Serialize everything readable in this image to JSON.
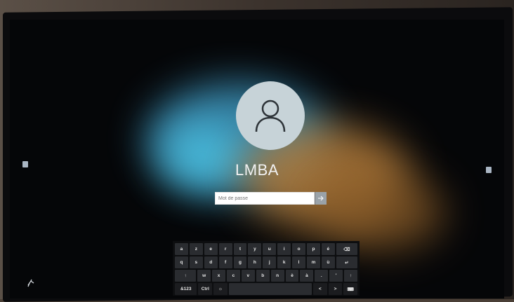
{
  "user": {
    "name": "LMBA"
  },
  "password": {
    "placeholder": "Mot de passe",
    "value": ""
  },
  "submit_icon": "arrow-right-icon",
  "keyboard": {
    "row1": [
      "a",
      "z",
      "e",
      "r",
      "t",
      "y",
      "u",
      "i",
      "o",
      "p",
      "é",
      "⌫"
    ],
    "row2": [
      "q",
      "s",
      "d",
      "f",
      "g",
      "h",
      "j",
      "k",
      "l",
      "m",
      "ù",
      "↵"
    ],
    "row3": [
      "↑",
      "w",
      "x",
      "c",
      "v",
      "b",
      "n",
      "è",
      "à",
      ".",
      "'",
      "↑"
    ],
    "row4": [
      "&123",
      "Ctrl",
      "☼",
      "",
      "<",
      ">",
      "⌨"
    ]
  },
  "colors": {
    "accent": "#9aa2a8",
    "avatar_bg": "#c7d3d8",
    "key_bg": "#2a2c30"
  },
  "icons": {
    "avatar": "user-silhouette-icon",
    "left_side": "settings-icon",
    "right_side": "settings-icon",
    "bottom_left": "accessibility-icon"
  }
}
